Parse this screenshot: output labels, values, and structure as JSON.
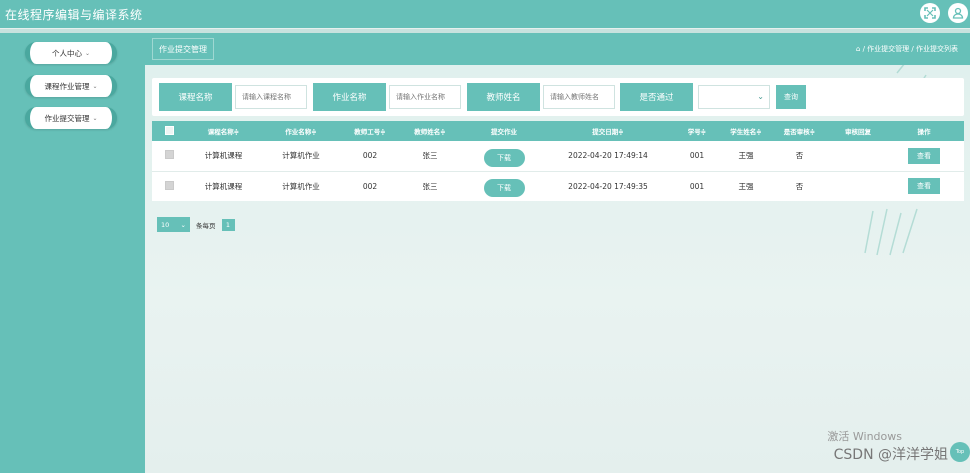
{
  "app": {
    "title": "在线程序编辑与编译系统"
  },
  "sidebar": {
    "items": [
      {
        "label": "个人中心"
      },
      {
        "label": "课程作业管理"
      },
      {
        "label": "作业提交管理"
      }
    ]
  },
  "crumb": {
    "tab": "作业提交管理",
    "path": "/ 作业提交管理 / 作业提交列表"
  },
  "search": {
    "fields": [
      {
        "label": "课程名称",
        "placeholder": "请输入课程名称"
      },
      {
        "label": "作业名称",
        "placeholder": "请输入作业名称"
      },
      {
        "label": "教师姓名",
        "placeholder": "请输入教师姓名"
      }
    ],
    "pass_label": "是否通过",
    "query_label": "查询"
  },
  "table": {
    "headers": [
      "课程名称≑",
      "作业名称≑",
      "教师工号≑",
      "教师姓名≑",
      "提交作业",
      "提交日期≑",
      "学号≑",
      "学生姓名≑",
      "是否审核≑",
      "审核回复",
      "操作"
    ],
    "rows": [
      {
        "course": "计算机课程",
        "homework": "计算机作业",
        "teacher_id": "002",
        "teacher_name": "张三",
        "submit_btn": "下载",
        "date": "2022-04-20 17:49:14",
        "student_id": "001",
        "student_name": "王强",
        "reviewed": "否",
        "reply": "",
        "action": "查看"
      },
      {
        "course": "计算机课程",
        "homework": "计算机作业",
        "teacher_id": "002",
        "teacher_name": "张三",
        "submit_btn": "下载",
        "date": "2022-04-20 17:49:35",
        "student_id": "001",
        "student_name": "王强",
        "reviewed": "否",
        "reply": "",
        "action": "查看"
      }
    ]
  },
  "pager": {
    "page_size": "10",
    "per_page_label": "条每页",
    "current_page": "1"
  },
  "overlay": {
    "windows": "激活 Windows",
    "csdn": "CSDN @洋洋学姐",
    "top": "Top"
  },
  "colors": {
    "accent": "#66c0b8"
  }
}
